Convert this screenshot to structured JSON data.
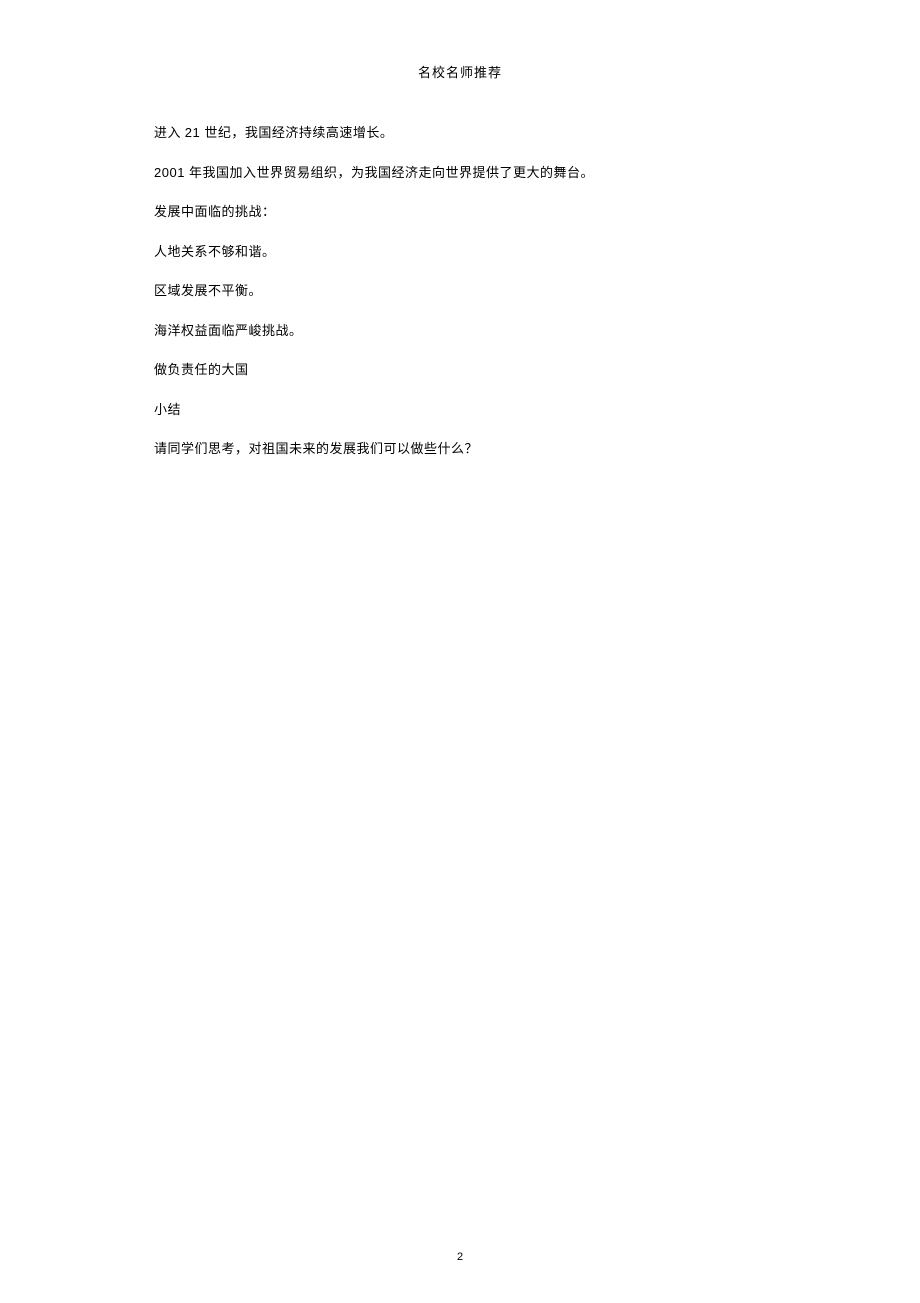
{
  "header": "名校名师推荐",
  "paragraphs": [
    {
      "segments": [
        {
          "text": "进入 ",
          "latin": false
        },
        {
          "text": "21 ",
          "latin": true
        },
        {
          "text": "世纪，我国经济持续高速增长。",
          "latin": false
        }
      ]
    },
    {
      "segments": [
        {
          "text": "2001 ",
          "latin": true
        },
        {
          "text": "年我国加入世界贸易组织，为我国经济走向世界提供了更大的舞台。",
          "latin": false
        }
      ]
    },
    {
      "segments": [
        {
          "text": "发展中面临的挑战：",
          "latin": false
        }
      ]
    },
    {
      "segments": [
        {
          "text": "人地关系不够和谐。",
          "latin": false
        }
      ]
    },
    {
      "segments": [
        {
          "text": "区域发展不平衡。",
          "latin": false
        }
      ]
    },
    {
      "segments": [
        {
          "text": "海洋权益面临严峻挑战。",
          "latin": false
        }
      ]
    },
    {
      "segments": [
        {
          "text": "做负责任的大国",
          "latin": false
        }
      ]
    },
    {
      "segments": [
        {
          "text": "小结",
          "latin": false
        }
      ]
    },
    {
      "segments": [
        {
          "text": "请同学们思考，对祖国未来的发展我们可以做些什么？",
          "latin": false
        }
      ]
    }
  ],
  "page_number": "2"
}
